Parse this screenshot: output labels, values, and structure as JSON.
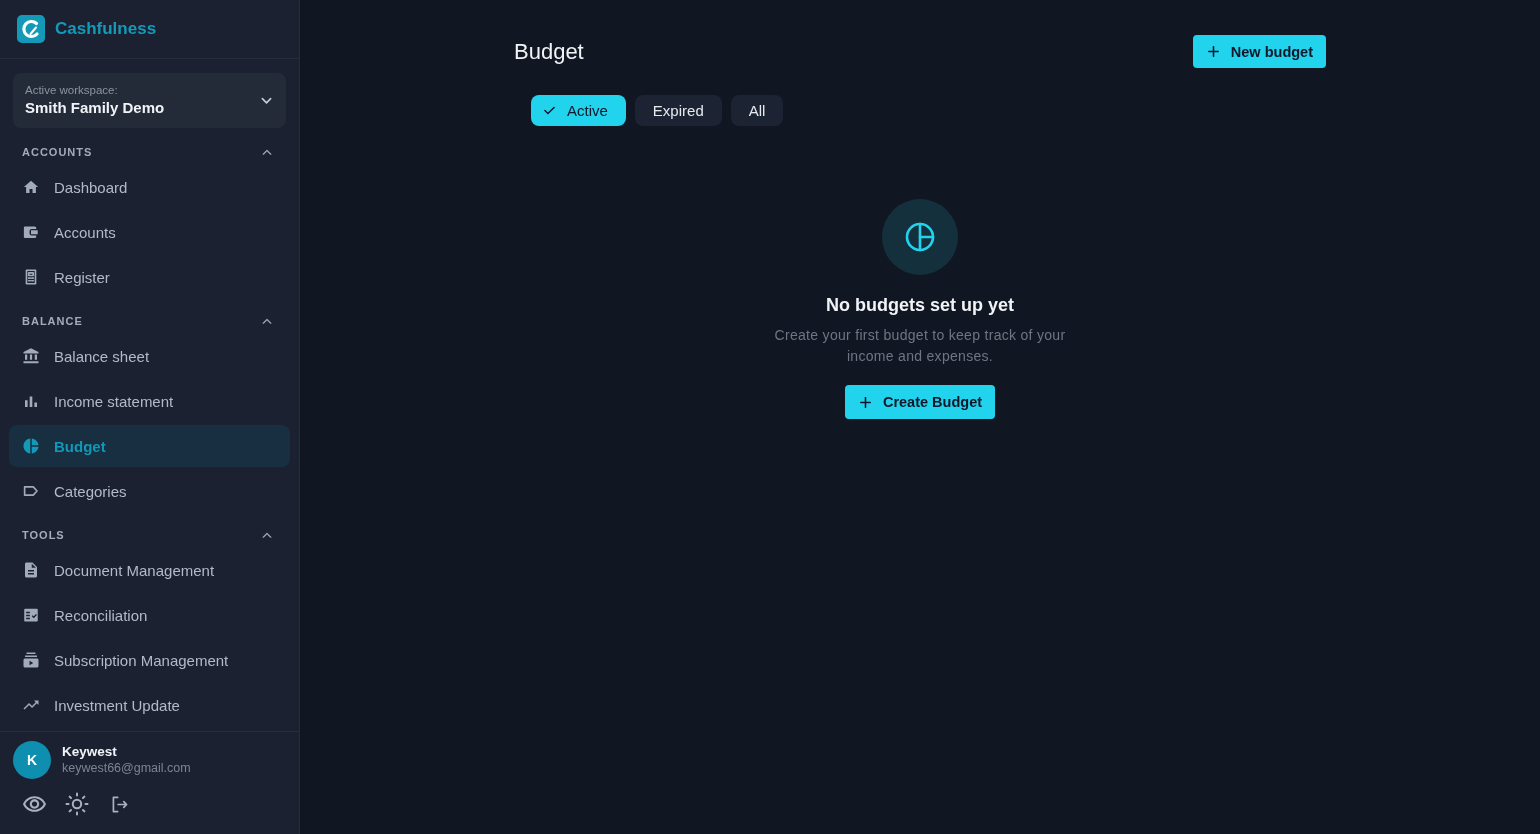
{
  "app": {
    "name": "Cashfulness"
  },
  "workspace": {
    "label": "Active workspace:",
    "name": "Smith Family Demo"
  },
  "nav_sections": [
    {
      "title": "ACCOUNTS",
      "expanded": true,
      "items": [
        {
          "label": "Dashboard",
          "selected": false
        },
        {
          "label": "Accounts",
          "selected": false
        },
        {
          "label": "Register",
          "selected": false
        }
      ]
    },
    {
      "title": "BALANCE",
      "expanded": true,
      "items": [
        {
          "label": "Balance sheet",
          "selected": false
        },
        {
          "label": "Income statement",
          "selected": false
        },
        {
          "label": "Budget",
          "selected": true
        },
        {
          "label": "Categories",
          "selected": false
        }
      ]
    },
    {
      "title": "TOOLS",
      "expanded": true,
      "items": [
        {
          "label": "Document Management",
          "selected": false
        },
        {
          "label": "Reconciliation",
          "selected": false
        },
        {
          "label": "Subscription Management",
          "selected": false
        },
        {
          "label": "Investment Update",
          "selected": false
        }
      ]
    }
  ],
  "user": {
    "initial": "K",
    "name": "Keywest",
    "email": "keywest66@gmail.com"
  },
  "page": {
    "title": "Budget",
    "new_button": "New budget"
  },
  "filters": [
    {
      "label": "Active",
      "selected": true
    },
    {
      "label": "Expired",
      "selected": false
    },
    {
      "label": "All",
      "selected": false
    }
  ],
  "empty_state": {
    "title": "No budgets set up yet",
    "description": "Create your first budget to keep track of your income and expenses.",
    "button": "Create Budget"
  }
}
